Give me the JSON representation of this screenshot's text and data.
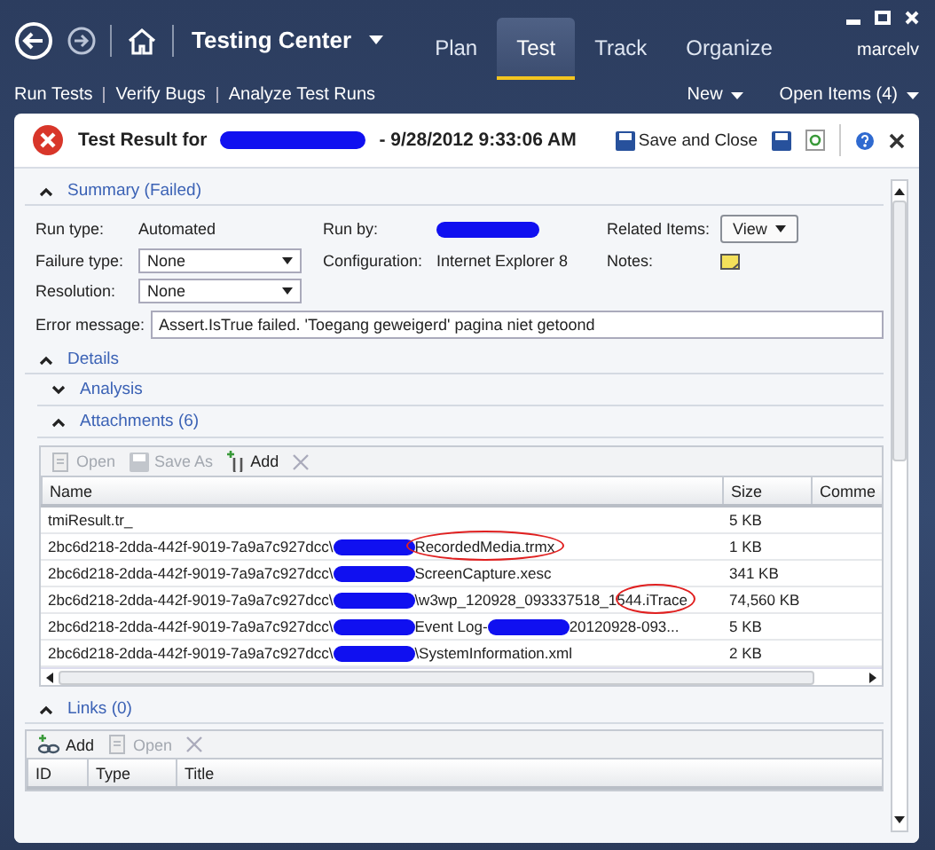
{
  "app": {
    "title": "Testing Center",
    "user": "marcelv"
  },
  "tabs": [
    {
      "label": "Plan",
      "selected": false
    },
    {
      "label": "Test",
      "selected": true
    },
    {
      "label": "Track",
      "selected": false
    },
    {
      "label": "Organize",
      "selected": false
    }
  ],
  "subnav": {
    "links": [
      "Run Tests",
      "Verify Bugs",
      "Analyze Test Runs"
    ],
    "menus": [
      "New",
      "Open Items (4)"
    ]
  },
  "document": {
    "title_prefix": "Test Result for",
    "title_suffix": "- 9/28/2012 9:33:06 AM",
    "save_and_close": "Save and Close"
  },
  "summary": {
    "title": "Summary (Failed)",
    "expanded": true,
    "fields": [
      {
        "label": "Run type:",
        "kind": "text",
        "value": "Automated"
      },
      {
        "label": "Run by:",
        "kind": "redacted"
      },
      {
        "label": "Related Items:",
        "kind": "button",
        "value": "View"
      },
      {
        "label": "Failure type:",
        "kind": "dropdown",
        "value": "None"
      },
      {
        "label": "Configuration:",
        "kind": "text",
        "value": "Internet Explorer 8"
      },
      {
        "label": "Notes:",
        "kind": "note"
      },
      {
        "label": "Resolution:",
        "kind": "dropdown",
        "value": "None"
      }
    ],
    "error_label": "Error message:",
    "error_value": "Assert.IsTrue failed. 'Toegang geweigerd' pagina niet getoond"
  },
  "details": {
    "title": "Details",
    "expanded": true,
    "children": [
      {
        "title": "Analysis",
        "expanded": false
      },
      {
        "title": "Attachments (6)",
        "expanded": true
      }
    ]
  },
  "attachments": {
    "toolbar": [
      {
        "label": "Open",
        "kind": "open",
        "disabled": true
      },
      {
        "label": "Save As",
        "kind": "save",
        "disabled": true
      },
      {
        "label": "Add",
        "kind": "add",
        "disabled": false
      },
      {
        "kind": "delete",
        "disabled": true
      }
    ],
    "columns": [
      "Name",
      "Size",
      "Comme"
    ],
    "rows": [
      {
        "name": [
          {
            "kind": "text",
            "text": "tmiResult.tr_"
          }
        ],
        "size": "5 KB"
      },
      {
        "name": [
          {
            "kind": "text",
            "text": "2bc6d218-2dda-442f-9019-7a9a7c927dcc\\"
          },
          {
            "kind": "redacted"
          },
          {
            "kind": "text",
            "text": "RecordedMedia.trmx",
            "circled": true
          }
        ],
        "size": "1 KB"
      },
      {
        "name": [
          {
            "kind": "text",
            "text": "2bc6d218-2dda-442f-9019-7a9a7c927dcc\\"
          },
          {
            "kind": "redacted"
          },
          {
            "kind": "text",
            "text": "ScreenCapture.xesc"
          }
        ],
        "size": "341 KB"
      },
      {
        "name": [
          {
            "kind": "text",
            "text": "2bc6d218-2dda-442f-9019-7a9a7c927dcc\\"
          },
          {
            "kind": "redacted"
          },
          {
            "kind": "text",
            "text": "\\w3wp_120928_093337518_15"
          },
          {
            "kind": "text",
            "text": "44.iTrace",
            "circled": true
          }
        ],
        "size": "74,560 KB"
      },
      {
        "name": [
          {
            "kind": "text",
            "text": "2bc6d218-2dda-442f-9019-7a9a7c927dcc\\"
          },
          {
            "kind": "redacted"
          },
          {
            "kind": "text",
            "text": "Event Log-"
          },
          {
            "kind": "redacted"
          },
          {
            "kind": "text",
            "text": "20120928-093..."
          }
        ],
        "size": "5 KB"
      },
      {
        "name": [
          {
            "kind": "text",
            "text": "2bc6d218-2dda-442f-9019-7a9a7c927dcc\\"
          },
          {
            "kind": "redacted"
          },
          {
            "kind": "text",
            "text": "\\SystemInformation.xml"
          }
        ],
        "size": "2 KB"
      }
    ]
  },
  "links": {
    "title": "Links (0)",
    "expanded": true,
    "toolbar": [
      {
        "label": "Add",
        "kind": "link",
        "disabled": false
      },
      {
        "label": "Open",
        "kind": "open",
        "disabled": true
      },
      {
        "kind": "delete",
        "disabled": true
      }
    ],
    "columns": [
      "ID",
      "Type",
      "Title"
    ]
  }
}
